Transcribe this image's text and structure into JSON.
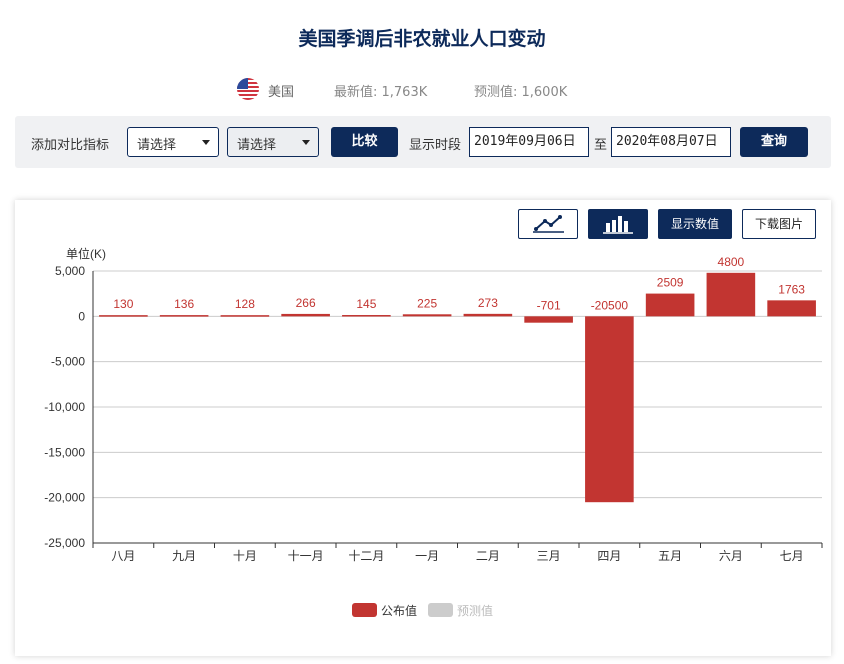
{
  "title": "美国季调后非农就业人口变动",
  "meta": {
    "country": "美国",
    "latest": "最新值: 1,763K",
    "forecast": "预测值: 1,600K"
  },
  "filter": {
    "compare_label": "添加对比指标",
    "select1": "请选择",
    "select2": "请选择",
    "compare_button": "比较",
    "period_label": "显示时段",
    "start_date": "2019年09月06日",
    "to_label": "至",
    "end_date": "2020年08月07日",
    "query_button": "查询"
  },
  "toolbar": {
    "line_icon": "line-chart-icon",
    "bar_icon": "bar-chart-icon",
    "show_values": "显示数值",
    "download": "下载图片"
  },
  "colors": {
    "navy": "#0d2a5a",
    "bar": "#c23531",
    "forecast": "#cccccc"
  },
  "chart_data": {
    "type": "bar",
    "unit_label": "单位(K)",
    "categories": [
      "八月",
      "九月",
      "十月",
      "十一月",
      "十二月",
      "一月",
      "二月",
      "三月",
      "四月",
      "五月",
      "六月",
      "七月"
    ],
    "series": [
      {
        "name": "公布值",
        "values": [
          130,
          136,
          128,
          266,
          145,
          225,
          273,
          -701,
          -20500,
          2509,
          4800,
          1763
        ]
      },
      {
        "name": "预测值",
        "values": []
      }
    ],
    "ylim": [
      -25000,
      5000
    ],
    "yticks": [
      5000,
      0,
      -5000,
      -10000,
      -15000,
      -20000,
      -25000
    ],
    "ytick_labels": [
      "5,000",
      "0",
      "-5,000",
      "-10,000",
      "-15,000",
      "-20,000",
      "-25,000"
    ],
    "grid": true,
    "data_labels": true,
    "legend_position": "bottom"
  }
}
